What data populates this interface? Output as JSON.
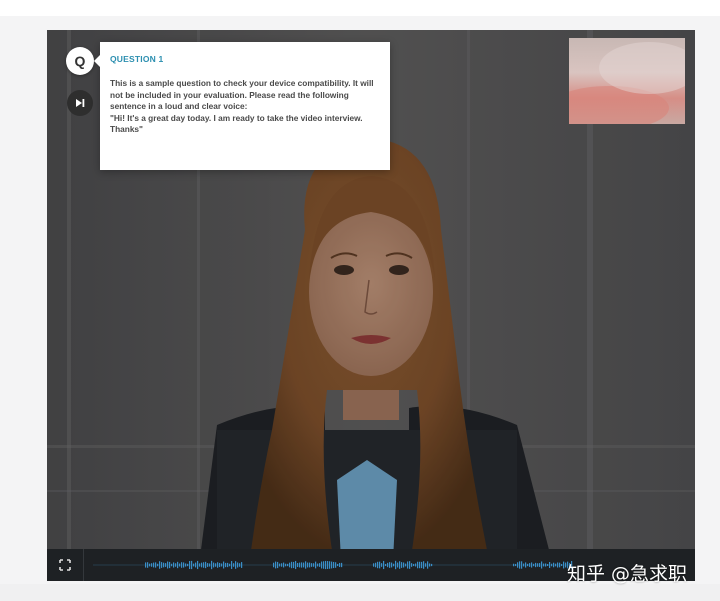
{
  "question": {
    "badge_letter": "Q",
    "title": "QUESTION 1",
    "body": "This is a sample question to check your device compatibility. It will not be included in your evaluation. Please read the following sentence in a loud and clear voice:",
    "quote": "\"Hi! It's a great day today. I am ready to take the video interview. Thanks\""
  },
  "icons": {
    "badge": "question-badge",
    "skip": "skip-forward-icon",
    "fullscreen": "fullscreen-icon"
  },
  "colors": {
    "question_title": "#2c8fb0",
    "control_bar": "#1e2124",
    "waveform": "#3a8fc8"
  },
  "watermark": {
    "text": "知乎 @急求职"
  }
}
